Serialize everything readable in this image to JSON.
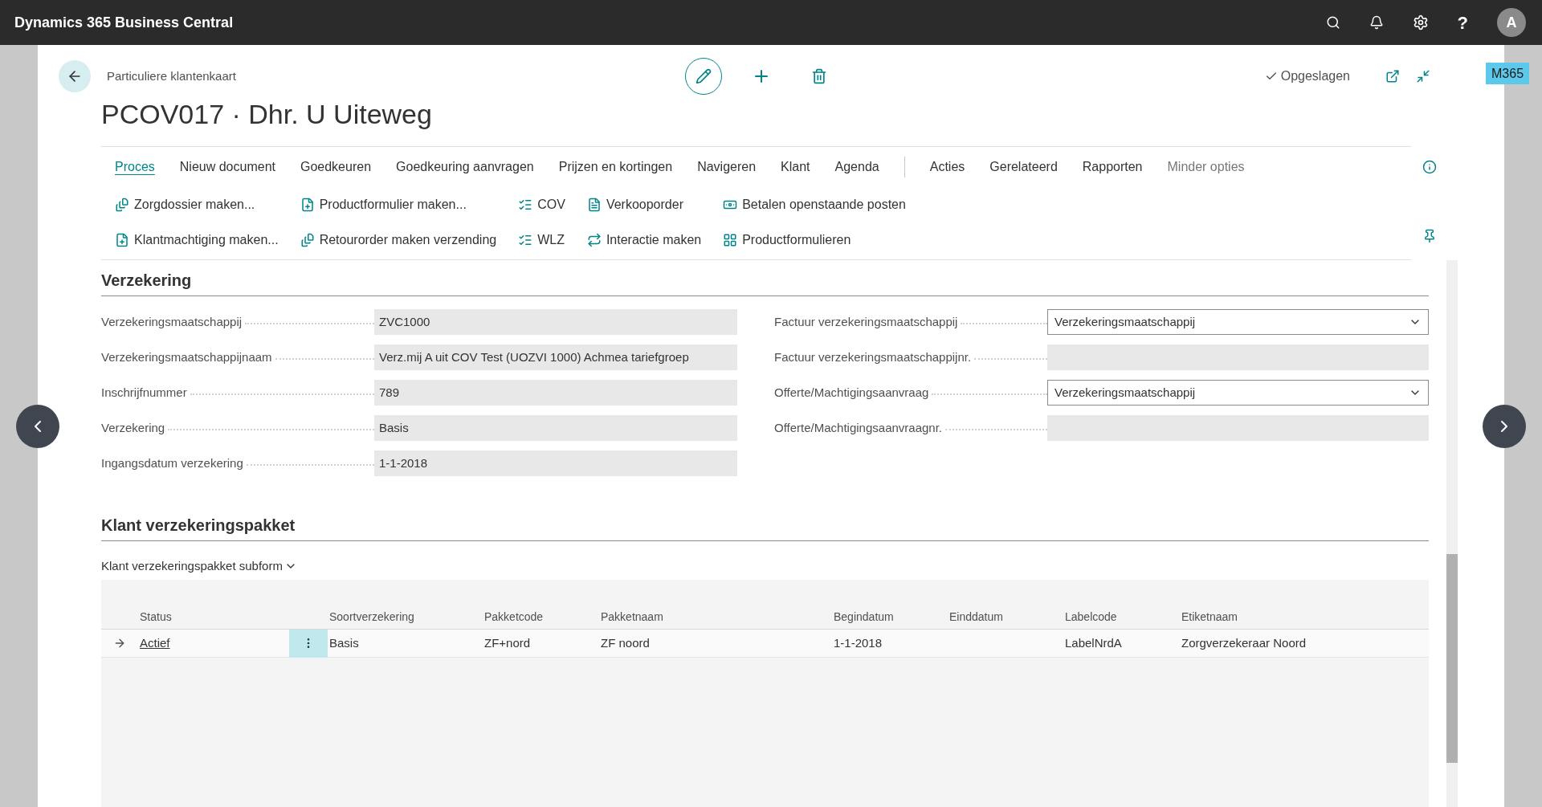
{
  "app_bar": {
    "title": "Dynamics 365 Business Central",
    "help": "?",
    "avatar": "A"
  },
  "header": {
    "breadcrumb": "Particuliere klantenkaart",
    "title": "PCOV017 · Dhr. U Uiteweg",
    "save_status": "Opgeslagen"
  },
  "badge": "M365",
  "menu": {
    "tabs": [
      {
        "label": "Proces",
        "selected": true
      },
      {
        "label": "Nieuw document",
        "selected": false
      },
      {
        "label": "Goedkeuren",
        "selected": false
      },
      {
        "label": "Goedkeuring aanvragen",
        "selected": false
      },
      {
        "label": "Prijzen en kortingen",
        "selected": false
      },
      {
        "label": "Navigeren",
        "selected": false
      },
      {
        "label": "Klant",
        "selected": false
      },
      {
        "label": "Agenda",
        "selected": false
      }
    ],
    "groups": [
      "Acties",
      "Gerelateerd",
      "Rapporten"
    ],
    "toggle": "Minder opties"
  },
  "action_columns": [
    [
      {
        "label": "Zorgdossier maken...",
        "kind": "record"
      },
      {
        "label": "Klantmachtiging maken...",
        "kind": "create"
      }
    ],
    [
      {
        "label": "Productformulier maken...",
        "kind": "create"
      },
      {
        "label": "Retourorder maken verzending",
        "kind": "record"
      }
    ],
    [
      {
        "label": "COV",
        "kind": "list"
      },
      {
        "label": "WLZ",
        "kind": "list"
      }
    ],
    [
      {
        "label": "Verkooporder",
        "kind": "document"
      },
      {
        "label": "Interactie maken",
        "kind": "exchange"
      }
    ],
    [
      {
        "label": "Betalen openstaande posten",
        "kind": "payment"
      },
      {
        "label": "Productformulieren",
        "kind": "forms"
      }
    ]
  ],
  "section": {
    "title": "Verzekering",
    "fields_left": [
      {
        "label": "Verzekeringsmaatschappij",
        "value": "ZVC1000",
        "kind": "text"
      },
      {
        "label": "Verzekeringsmaatschappijnaam",
        "value": "Verz.mij A uit COV Test (UOZVI 1000) Achmea tariefgroep",
        "kind": "text"
      },
      {
        "label": "Inschrijfnummer",
        "value": "789",
        "kind": "text"
      },
      {
        "label": "Verzekering",
        "value": "Basis",
        "kind": "text"
      },
      {
        "label": "Ingangsdatum verzekering",
        "value": "1-1-2018",
        "kind": "text"
      }
    ],
    "fields_right": [
      {
        "label": "Factuur verzekeringsmaatschappij",
        "value": "Verzekeringsmaatschappij",
        "kind": "dropdown"
      },
      {
        "label": "Factuur verzekeringsmaatschappijnr.",
        "kind": "text"
      },
      {
        "label": "Offerte/Machtigingsaanvraag",
        "value": "Verzekeringsmaatschappij",
        "kind": "dropdown"
      },
      {
        "label": "Offerte/Machtigingsaanvraagnr.",
        "kind": "text"
      }
    ]
  },
  "subform_section": {
    "title": "Klant verzekeringspakket",
    "subform_title": "Klant verzekeringspakket subform",
    "columns": [
      "Status",
      "Soortverzekering",
      "Pakketcode",
      "Pakketnaam",
      "Begindatum",
      "Einddatum",
      "Labelcode",
      "Etiketnaam"
    ],
    "rows": [
      {
        "selected": true,
        "cells": [
          "Actief",
          "Basis",
          "ZF+nord",
          "ZF noord",
          "1-1-2018",
          "",
          "LabelNrdA",
          "Zorgverzekeraar Noord"
        ]
      }
    ]
  }
}
